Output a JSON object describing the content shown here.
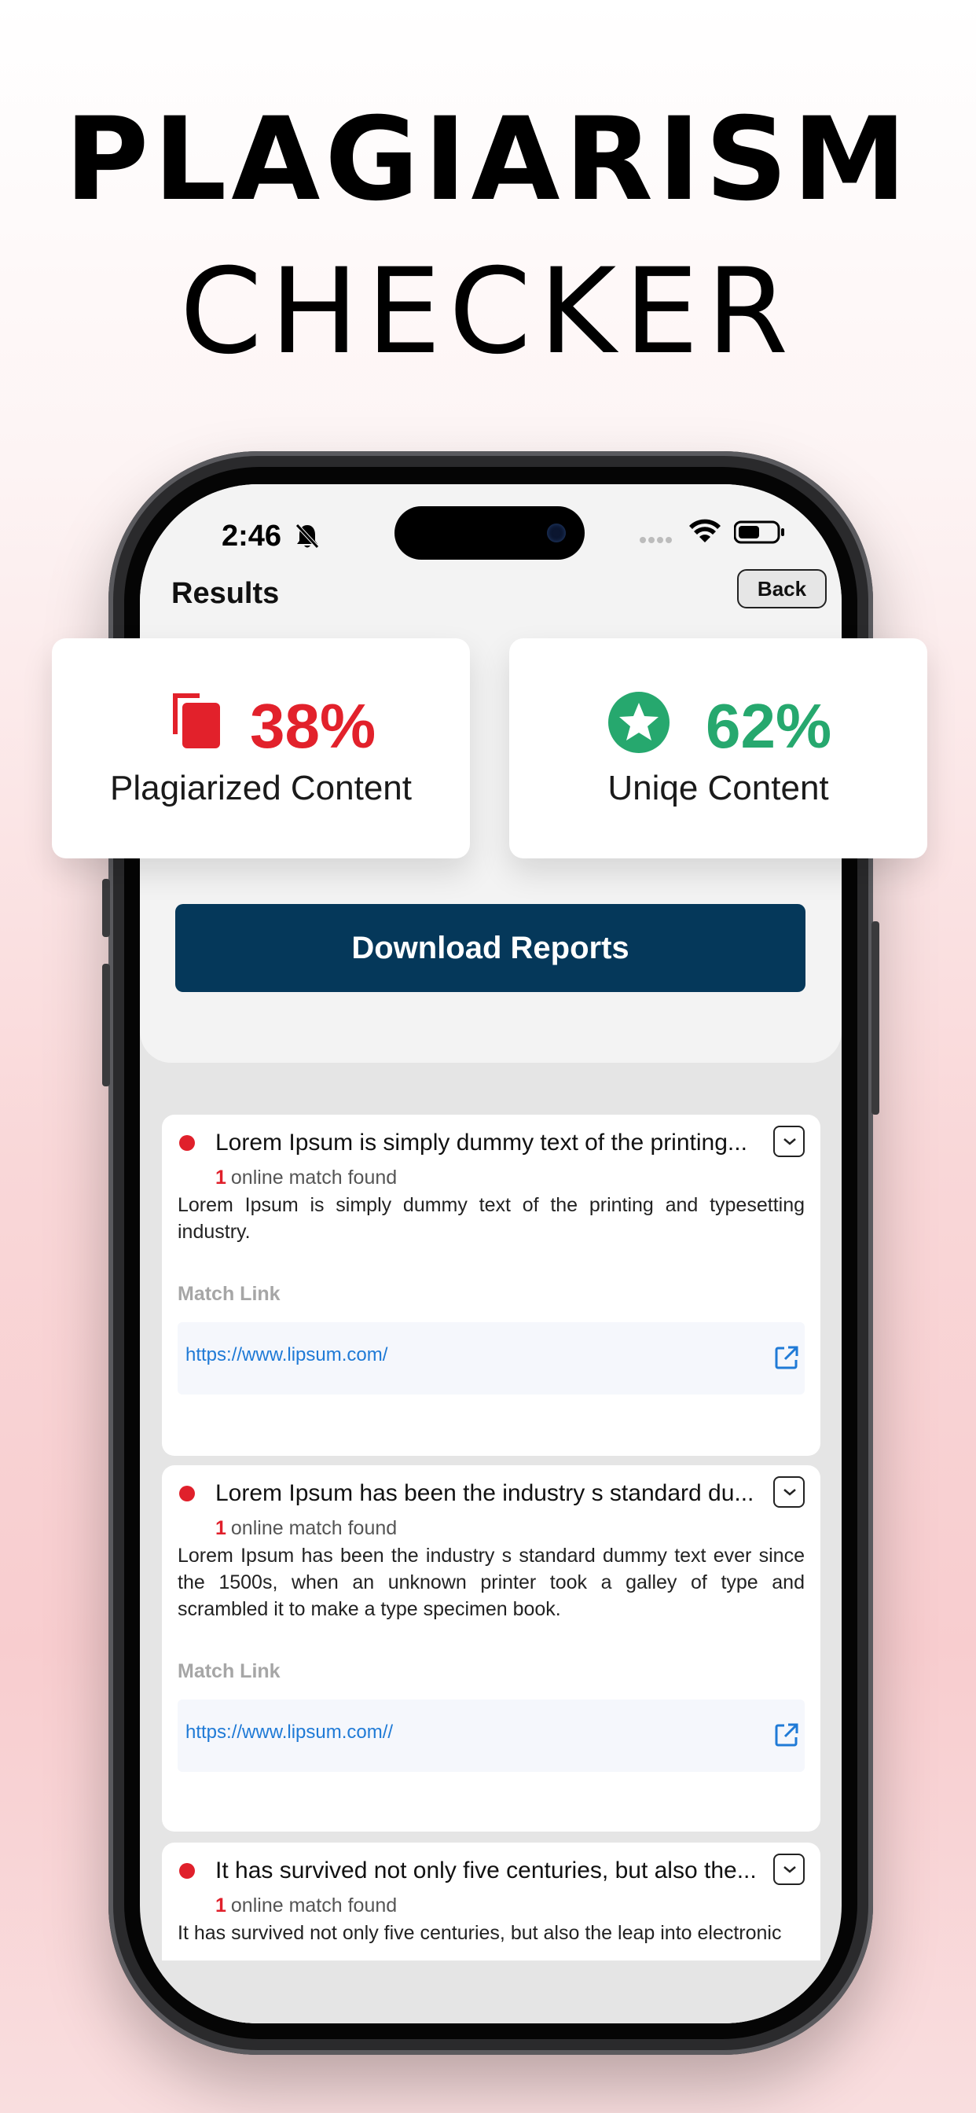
{
  "promo": {
    "title_line1": "PLAGIARISM",
    "title_line2": "CHECKER"
  },
  "status_bar": {
    "time": "2:46"
  },
  "header": {
    "title": "Results",
    "back_label": "Back"
  },
  "stats": {
    "plagiarized": {
      "value": "38%",
      "label": "Plagiarized Content",
      "color": "#e2212b",
      "icon": "copy-icon"
    },
    "unique": {
      "value": "62%",
      "label": "Uniqe Content",
      "color": "#26a86e",
      "icon": "star-icon"
    }
  },
  "download_label": "Download Reports",
  "results": [
    {
      "title": "Lorem Ipsum is simply dummy text of the printing...",
      "count": "1",
      "count_label": "online match found",
      "description": "Lorem Ipsum is simply dummy text of the printing and typesetting industry.",
      "match_label": "Match Link",
      "url": "https://www.lipsum.com/"
    },
    {
      "title": "Lorem Ipsum has been the industry  s standard du...",
      "count": "1",
      "count_label": "online match found",
      "description": "Lorem Ipsum has been the industry  s standard dummy text ever since the 1500s, when an unknown printer took a galley of type and scrambled it to make a type specimen book.",
      "match_label": "Match Link",
      "url": "https://www.lipsum.com//"
    },
    {
      "title": "It has survived not only five centuries, but also the...",
      "count": "1",
      "count_label": "online match found",
      "description": "It has survived not only five centuries, but also the leap into electronic"
    }
  ]
}
